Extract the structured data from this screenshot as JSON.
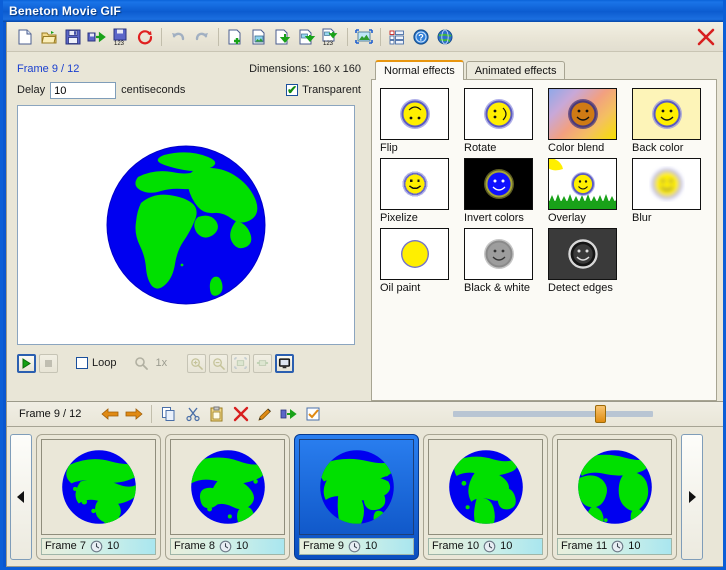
{
  "window": {
    "title": "Beneton Movie GIF",
    "close_label": "✕"
  },
  "toolbar": {
    "buttons": [
      {
        "name": "new-file",
        "icon": "new-document-icon",
        "label": "New"
      },
      {
        "name": "open-file",
        "icon": "open-folder-icon",
        "label": "Open"
      },
      {
        "name": "save-file",
        "icon": "save-disk-icon",
        "label": "Save"
      },
      {
        "name": "save-as",
        "icon": "save-as-icon",
        "label": "Save as"
      },
      {
        "name": "save-numbered",
        "icon": "save-numbered-icon",
        "label": "Save frames"
      },
      {
        "name": "reload",
        "icon": "reload-refresh-icon",
        "label": "Reload"
      },
      {
        "name": "undo",
        "icon": "undo-arrow-icon",
        "label": "Undo"
      },
      {
        "name": "redo",
        "icon": "redo-arrow-icon",
        "label": "Redo"
      },
      {
        "name": "new-frame",
        "icon": "new-frame-icon",
        "label": "New frame"
      },
      {
        "name": "insert-image",
        "icon": "insert-image-icon",
        "label": "Insert image"
      },
      {
        "name": "import-frame",
        "icon": "import-frame-icon",
        "label": "Import frame"
      },
      {
        "name": "export-frame",
        "icon": "export-frame-icon",
        "label": "Export frame"
      },
      {
        "name": "export-numbered",
        "icon": "export-numbered-icon",
        "label": "Export frames"
      },
      {
        "name": "resize-image",
        "icon": "resize-image-icon",
        "label": "Resize"
      },
      {
        "name": "frame-list",
        "icon": "frame-list-icon",
        "label": "Frame properties"
      },
      {
        "name": "help",
        "icon": "help-question-icon",
        "label": "Help"
      },
      {
        "name": "website",
        "icon": "globe-web-icon",
        "label": "Web site"
      }
    ]
  },
  "editor": {
    "frame_index_label": "Frame 9 / 12",
    "dimensions_label": "Dimensions: 160 x 160",
    "delay_label": "Delay",
    "delay_value": "10",
    "delay_units": "centiseconds",
    "transparent_label": "Transparent",
    "transparent_checked": true
  },
  "playback": {
    "play_label": "▶",
    "stop_label": "■",
    "loop_label": "Loop",
    "loop_checked": false,
    "zoom_level": "1x",
    "buttons": [
      {
        "name": "zoom-in",
        "icon": "magnifier-plus-icon"
      },
      {
        "name": "zoom-out",
        "icon": "magnifier-minus-icon"
      },
      {
        "name": "fit-image",
        "icon": "fit-image-icon"
      },
      {
        "name": "actual-size",
        "icon": "actual-size-icon"
      },
      {
        "name": "full-screen",
        "icon": "monitor-screen-icon"
      }
    ]
  },
  "effects": {
    "tabs": [
      {
        "label": "Normal effects",
        "active": true
      },
      {
        "label": "Animated effects",
        "active": false
      }
    ],
    "items": [
      {
        "label": "Flip",
        "thumb": "flip"
      },
      {
        "label": "Rotate",
        "thumb": "rotate"
      },
      {
        "label": "Color blend",
        "thumb": "colorblend"
      },
      {
        "label": "Back color",
        "thumb": "backcolor"
      },
      {
        "label": "Pixelize",
        "thumb": "pixelize"
      },
      {
        "label": "Invert colors",
        "thumb": "invert"
      },
      {
        "label": "Overlay",
        "thumb": "overlay"
      },
      {
        "label": "Blur",
        "thumb": "blur"
      },
      {
        "label": "Oil paint",
        "thumb": "oilpaint"
      },
      {
        "label": "Black & white",
        "thumb": "bw"
      },
      {
        "label": "Detect edges",
        "thumb": "edges"
      }
    ]
  },
  "frames_toolbar": {
    "frame_index_label": "Frame 9 / 12",
    "buttons": [
      {
        "name": "previous-frame",
        "icon": "arrow-left-icon"
      },
      {
        "name": "next-frame",
        "icon": "arrow-right-icon"
      },
      {
        "name": "copy-frame",
        "icon": "copy-icon"
      },
      {
        "name": "cut-frame",
        "icon": "scissors-cut-icon"
      },
      {
        "name": "paste-frame",
        "icon": "paste-clipboard-icon"
      },
      {
        "name": "delete-frame",
        "icon": "delete-cross-icon"
      },
      {
        "name": "edit-frame",
        "icon": "pencil-edit-icon"
      },
      {
        "name": "move-frame",
        "icon": "move-frame-icon"
      },
      {
        "name": "select-frame",
        "icon": "checkbox-select-icon"
      }
    ],
    "slider_position_percent": 71
  },
  "filmstrip": {
    "scroll_left_label": "◀",
    "scroll_right_label": "▶",
    "frames": [
      {
        "label": "Frame 7",
        "delay": "10",
        "selected": false,
        "rotation": 90
      },
      {
        "label": "Frame 8",
        "delay": "10",
        "selected": false,
        "rotation": 45
      },
      {
        "label": "Frame 9",
        "delay": "10",
        "selected": true,
        "rotation": 0
      },
      {
        "label": "Frame 10",
        "delay": "10",
        "selected": false,
        "rotation": -25
      },
      {
        "label": "Frame 11",
        "delay": "10",
        "selected": false,
        "rotation": -55
      }
    ]
  },
  "colors": {
    "title_bar": "#0c5cd0",
    "panel_bg": "#e9e6d7",
    "tab_active_accent": "#e8960f",
    "selection_blue": "#0a4fc0",
    "globe_land": "#00e000",
    "globe_ocean": "#0000f0",
    "link_text": "#1a3fcf",
    "slider_thumb": "#e08c12"
  }
}
